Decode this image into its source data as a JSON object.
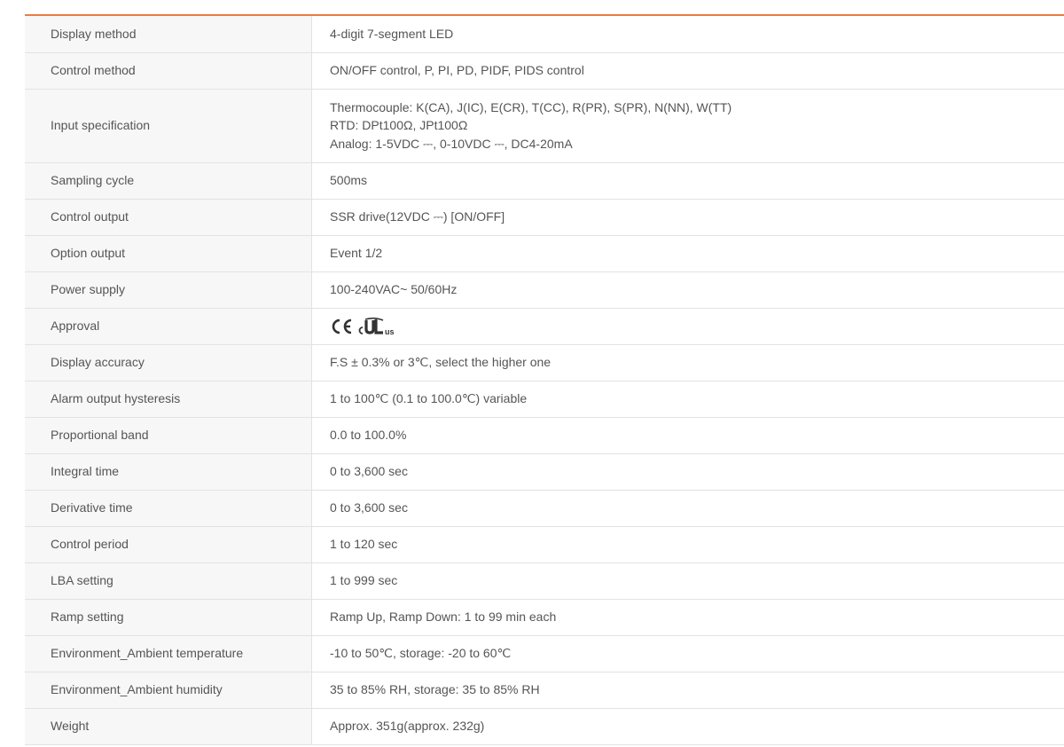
{
  "spec_table": {
    "rows": [
      {
        "label": "Display method",
        "lines": [
          "4-digit 7-segment LED"
        ]
      },
      {
        "label": "Control method",
        "lines": [
          "ON/OFF control, P, PI, PD, PIDF, PIDS control"
        ]
      },
      {
        "label": "Input specification",
        "lines": [
          "Thermocouple: K(CA), J(IC), E(CR), T(CC), R(PR), S(PR), N(NN), W(TT)",
          "RTD: DPt100Ω, JPt100Ω",
          "Analog: 1-5VDC ⎓, 0-10VDC ⎓, DC4-20mA"
        ]
      },
      {
        "label": "Sampling cycle",
        "lines": [
          "500ms"
        ]
      },
      {
        "label": "Control output",
        "lines": [
          "SSR drive(12VDC ⎓) [ON/OFF]"
        ]
      },
      {
        "label": "Option output",
        "lines": [
          "Event 1/2"
        ]
      },
      {
        "label": "Power supply",
        "lines": [
          "100-240VAC~ 50/60Hz"
        ]
      },
      {
        "label": "Approval",
        "lines": [],
        "marks": {
          "ce": "CE",
          "cul_c": "c",
          "cul_mark": "UL",
          "cul_us": "us"
        }
      },
      {
        "label": "Display accuracy",
        "lines": [
          "F.S ± 0.3% or 3℃, select the higher one"
        ]
      },
      {
        "label": "Alarm output hysteresis",
        "lines": [
          "1 to 100℃ (0.1 to 100.0℃) variable"
        ]
      },
      {
        "label": "Proportional band",
        "lines": [
          "0.0 to 100.0%"
        ]
      },
      {
        "label": "Integral time",
        "lines": [
          "0 to 3,600 sec"
        ]
      },
      {
        "label": "Derivative time",
        "lines": [
          "0 to 3,600 sec"
        ]
      },
      {
        "label": "Control period",
        "lines": [
          "1 to 120 sec"
        ]
      },
      {
        "label": "LBA setting",
        "lines": [
          "1 to 999 sec"
        ]
      },
      {
        "label": "Ramp setting",
        "lines": [
          "Ramp Up, Ramp Down: 1 to 99 min each"
        ]
      },
      {
        "label": "Environment_Ambient temperature",
        "lines": [
          "-10 to 50℃, storage: -20 to 60℃"
        ]
      },
      {
        "label": "Environment_Ambient humidity",
        "lines": [
          "35 to 85% RH, storage: 35 to 85% RH"
        ]
      },
      {
        "label": "Weight",
        "lines": [
          "Approx. 351g(approx. 232g)"
        ]
      }
    ]
  },
  "colors": {
    "accent_rule": "#f07a3a",
    "label_bg": "#f7f7f7",
    "text": "#555555",
    "border": "#e2e2e2"
  }
}
